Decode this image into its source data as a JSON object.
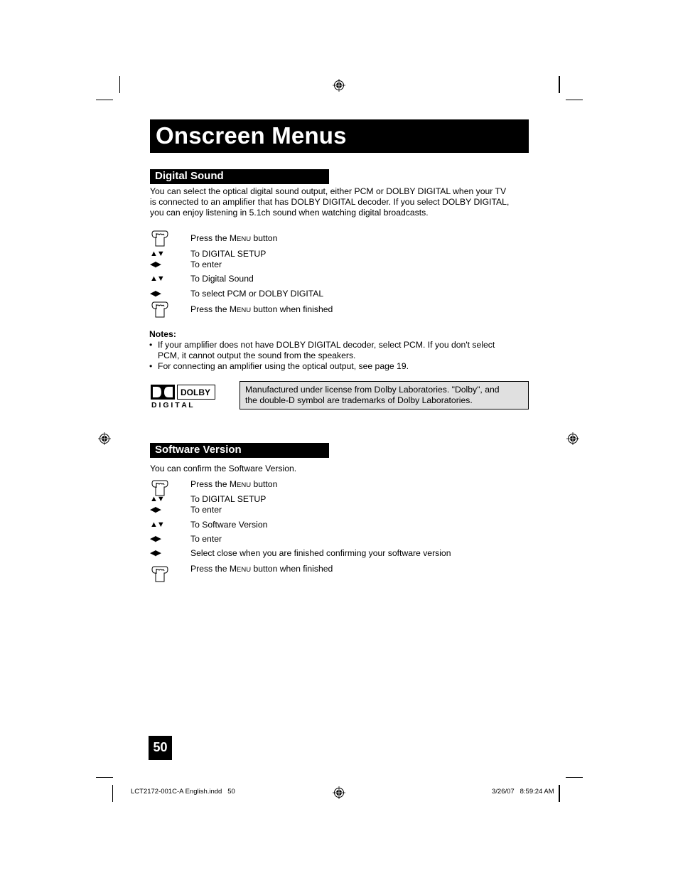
{
  "page": {
    "title": "Onscreen Menus",
    "page_number": "50"
  },
  "digital_sound": {
    "heading": "Digital Sound",
    "intro_lines": [
      "You can select the optical digital sound output, either PCM or DOLBY DIGITAL when your TV",
      "is connected to an amplifier that has DOLBY DIGITAL decoder.  If you select DOLBY DIGITAL,",
      "you can enjoy listening in 5.1ch sound when watching digital broadcasts."
    ],
    "steps": [
      {
        "icon": "hand-press-icon",
        "pre": "Press the M",
        "sc": "ENU",
        "post": " button"
      },
      {
        "icon": "up-down-arrows-icon",
        "glyph": "▲▼",
        "text": "To DIGITAL SETUP"
      },
      {
        "icon": "left-right-arrows-icon",
        "glyph": "◀▶",
        "text": "To enter"
      },
      {
        "icon": "up-down-arrows-icon",
        "glyph": "▲▼",
        "text": "To Digital Sound"
      },
      {
        "icon": "left-right-arrows-icon",
        "glyph": "◀▶",
        "text": "To select PCM or DOLBY DIGITAL"
      },
      {
        "icon": "hand-press-icon",
        "pre": "Press the M",
        "sc": "ENU",
        "post": " button when finished"
      }
    ],
    "notes_title": "Notes:",
    "notes": [
      {
        "bullet": "•",
        "lines": [
          "If your amplifier does not have DOLBY DIGITAL decoder, select PCM.  If you don't select",
          "PCM, it cannot output the sound from the speakers."
        ]
      },
      {
        "bullet": "•",
        "lines": [
          "For connecting an amplifier using the optical output, see page 19."
        ]
      }
    ],
    "dolby_logo": {
      "word": "DOLBY",
      "sub": "D I G I T A L"
    },
    "license_lines": [
      "Manufactured under license from Dolby Laboratories.  \"Dolby\", and",
      "the double-D symbol are trademarks of Dolby Laboratories."
    ]
  },
  "software_version": {
    "heading": "Software Version",
    "intro": "You can confirm the Software Version.",
    "steps": [
      {
        "icon": "hand-press-icon",
        "pre": "Press the M",
        "sc": "ENU",
        "post": " button"
      },
      {
        "icon": "up-down-arrows-icon",
        "glyph": "▲▼",
        "text": "To DIGITAL SETUP"
      },
      {
        "icon": "left-right-arrows-icon",
        "glyph": "◀▶",
        "text": "To enter"
      },
      {
        "icon": "up-down-arrows-icon",
        "glyph": "▲▼",
        "text": "To Software Version"
      },
      {
        "icon": "left-right-arrows-icon",
        "glyph": "◀▶",
        "text": "To enter"
      },
      {
        "icon": "left-right-arrows-icon",
        "glyph": "◀▶",
        "text": "Select close when you are finished confirming your software version"
      },
      {
        "icon": "hand-press-icon",
        "pre": "Press the M",
        "sc": "ENU",
        "post": " button when finished"
      }
    ]
  },
  "footer": {
    "file": "LCT2172-001C-A English.indd   50",
    "timestamp": "3/26/07   8:59:24 AM"
  }
}
